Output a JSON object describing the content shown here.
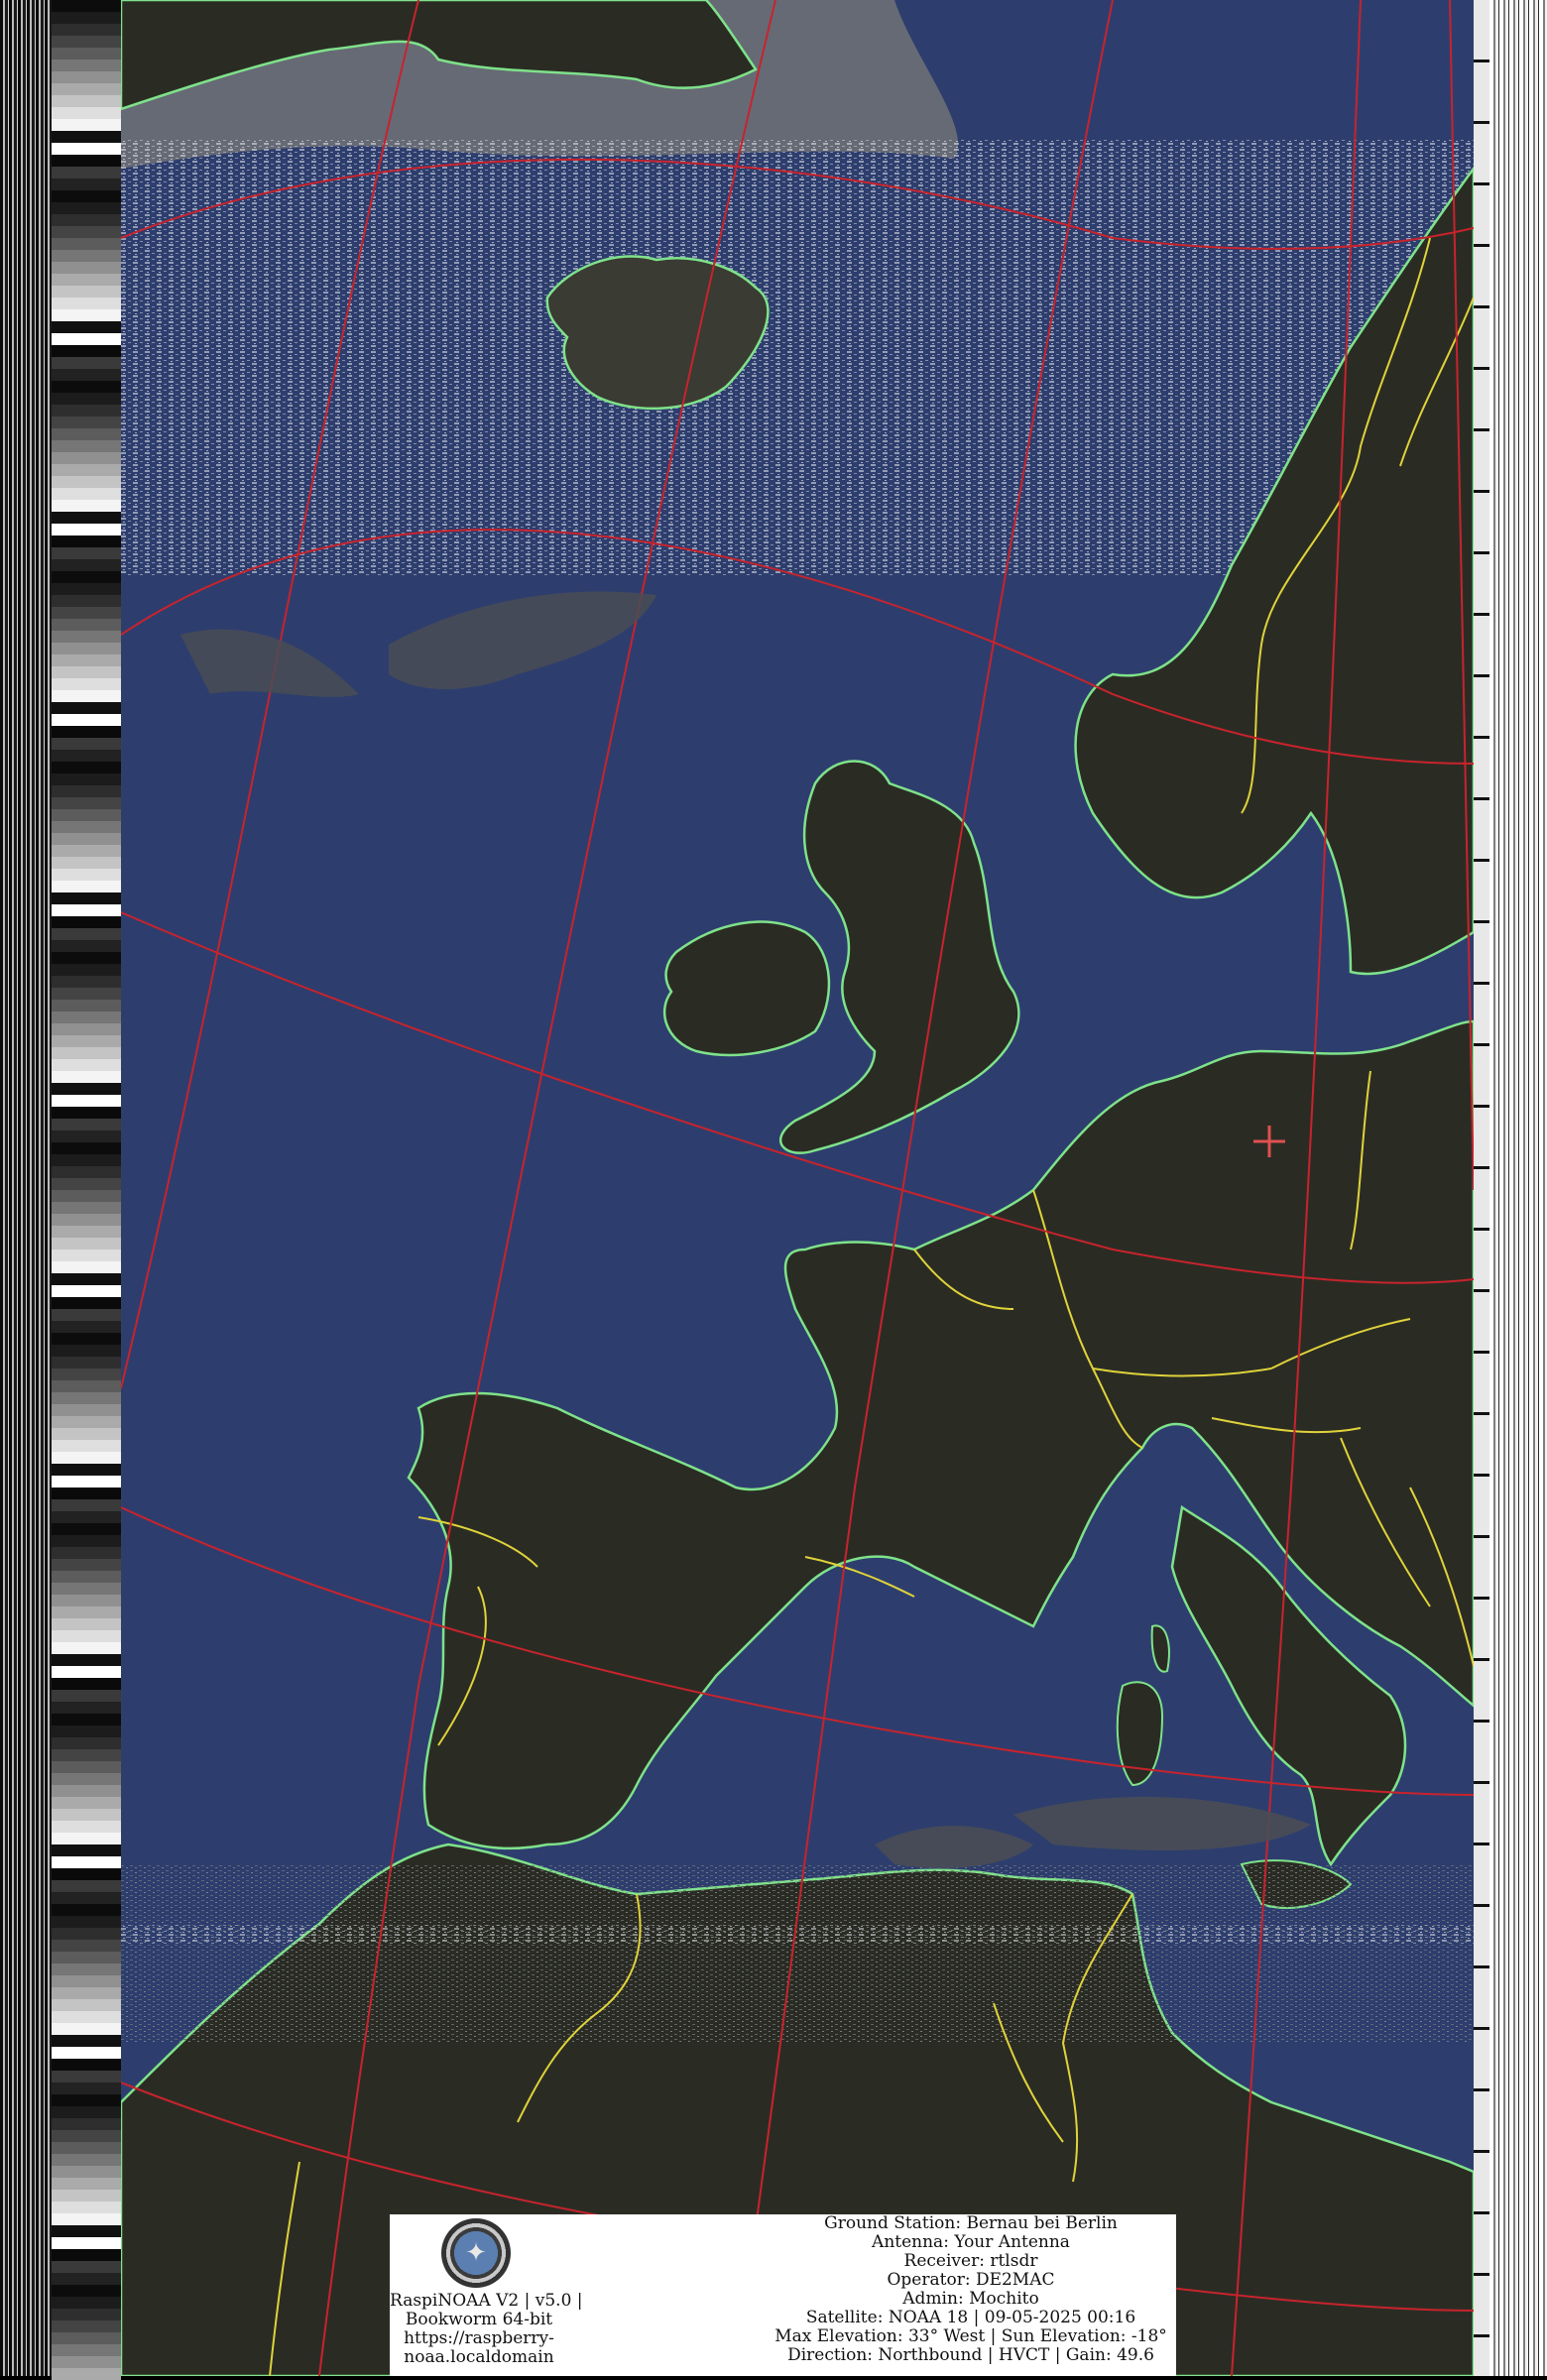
{
  "map": {
    "station_marker": "station-plus-icon",
    "colors": {
      "sea": "#2d3e6e",
      "land": "#2a2c24",
      "coastline": "#7fe28a",
      "borders": "#e0d23a",
      "graticule": "#c8232c",
      "marker": "#e05050",
      "clouds": "#d8dae0"
    }
  },
  "info": {
    "app_lines": [
      "RaspiNOAA V2 | v5.0 |",
      "Bookworm 64-bit",
      "https://raspberry-",
      "noaa.localdomain"
    ],
    "logo_icon": "satellite-logo-icon",
    "station_lines": [
      "Ground Station: Bernau bei Berlin",
      "Antenna: Your Antenna",
      "Receiver: rtlsdr",
      "Operator: DE2MAC",
      "Admin: Mochito",
      "Satellite: NOAA 18 | 09-05-2025 00:16",
      "Max Elevation: 33° West | Sun Elevation: -18°",
      "Direction: Northbound | HVCT | Gain: 49.6"
    ]
  }
}
